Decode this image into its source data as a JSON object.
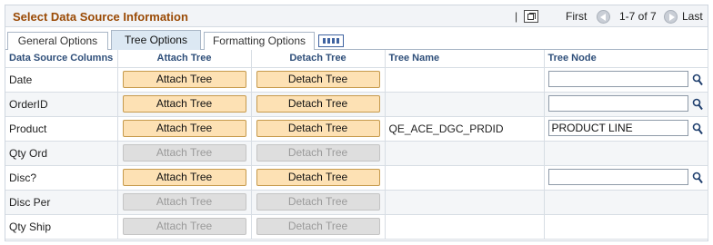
{
  "header": {
    "title": "Select Data Source Information",
    "nav_separator": "|",
    "first_label": "First",
    "range_label": "1-7 of 7",
    "last_label": "Last"
  },
  "tabs": [
    {
      "label": "General Options",
      "active": false
    },
    {
      "label": "Tree Options",
      "active": true
    },
    {
      "label": "Formatting Options",
      "active": false
    }
  ],
  "columns": {
    "data_source": "Data Source Columns",
    "attach": "Attach Tree",
    "detach": "Detach Tree",
    "tree_name": "Tree Name",
    "tree_node": "Tree Node"
  },
  "rows": [
    {
      "column": "Date",
      "attach_label": "Attach Tree",
      "detach_label": "Detach Tree",
      "enabled": true,
      "tree_name": "",
      "tree_node": "",
      "node_field": true
    },
    {
      "column": "OrderID",
      "attach_label": "Attach Tree",
      "detach_label": "Detach Tree",
      "enabled": true,
      "tree_name": "",
      "tree_node": "",
      "node_field": true
    },
    {
      "column": "Product",
      "attach_label": "Attach Tree",
      "detach_label": "Detach Tree",
      "enabled": true,
      "tree_name": "QE_ACE_DGC_PRDID",
      "tree_node": "PRODUCT LINE",
      "node_field": true
    },
    {
      "column": "Qty Ord",
      "attach_label": "Attach Tree",
      "detach_label": "Detach Tree",
      "enabled": false,
      "tree_name": "",
      "tree_node": "",
      "node_field": false
    },
    {
      "column": "Disc?",
      "attach_label": "Attach Tree",
      "detach_label": "Detach Tree",
      "enabled": true,
      "tree_name": "",
      "tree_node": "",
      "node_field": true
    },
    {
      "column": "Disc Per",
      "attach_label": "Attach Tree",
      "detach_label": "Detach Tree",
      "enabled": false,
      "tree_name": "",
      "tree_node": "",
      "node_field": false
    },
    {
      "column": "Qty Ship",
      "attach_label": "Attach Tree",
      "detach_label": "Detach Tree",
      "enabled": false,
      "tree_name": "",
      "tree_node": "",
      "node_field": false
    }
  ],
  "colors": {
    "title": "#9a4a05",
    "button_enabled": "#fde1b4",
    "button_disabled": "#dedede",
    "header_text": "#2f4f7a",
    "tab_active": "#dce8f3"
  },
  "icons": [
    "zoom-icon",
    "previous-icon",
    "next-icon",
    "grid-view-icon",
    "lookup-icon"
  ]
}
